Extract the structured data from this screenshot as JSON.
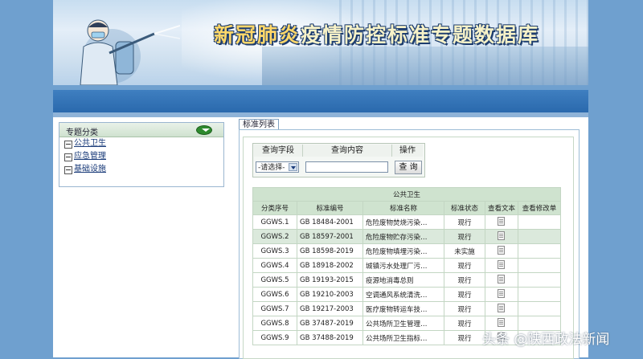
{
  "banner": {
    "title_accent": "新冠肺炎",
    "title_rest": "疫情防控标准专题数据库"
  },
  "category_panel": {
    "title": "专题分类",
    "items": [
      {
        "label": "公共卫生"
      },
      {
        "label": "应急管理"
      },
      {
        "label": "基础设施"
      }
    ]
  },
  "tab": {
    "label": "标准列表"
  },
  "query": {
    "headers": [
      "查询字段",
      "查询内容",
      "操作"
    ],
    "select_value": "-请选择-",
    "input_value": "",
    "button_label": "查 询"
  },
  "table": {
    "caption": "公共卫生",
    "columns": [
      "分类序号",
      "标准编号",
      "标准名称",
      "标准状态",
      "查看文本",
      "查看修改单"
    ],
    "rows": [
      {
        "seq": "GGWS.1",
        "code": "GB 18484-2001",
        "name": "危险废物焚烧污染…",
        "status": "现行"
      },
      {
        "seq": "GGWS.2",
        "code": "GB 18597-2001",
        "name": "危险废物贮存污染…",
        "status": "现行"
      },
      {
        "seq": "GGWS.3",
        "code": "GB 18598-2019",
        "name": "危险废物填埋污染…",
        "status": "未实施"
      },
      {
        "seq": "GGWS.4",
        "code": "GB 18918-2002",
        "name": "城镇污水处理厂污…",
        "status": "现行"
      },
      {
        "seq": "GGWS.5",
        "code": "GB 19193-2015",
        "name": "疫源地消毒总则",
        "status": "现行"
      },
      {
        "seq": "GGWS.6",
        "code": "GB 19210-2003",
        "name": "空调通风系统清洗…",
        "status": "现行"
      },
      {
        "seq": "GGWS.7",
        "code": "GB 19217-2003",
        "name": "医疗废物转运车技…",
        "status": "现行"
      },
      {
        "seq": "GGWS.8",
        "code": "GB 37487-2019",
        "name": "公共场所卫生管理…",
        "status": "现行"
      },
      {
        "seq": "GGWS.9",
        "code": "GB 37488-2019",
        "name": "公共场所卫生指标…",
        "status": "现行"
      }
    ]
  },
  "watermark": "头条 @陕西政法新闻",
  "icons": {
    "toggle": "collapse-toggle-icon",
    "doc": "document-icon",
    "checkbox": "collapse-box-icon"
  }
}
